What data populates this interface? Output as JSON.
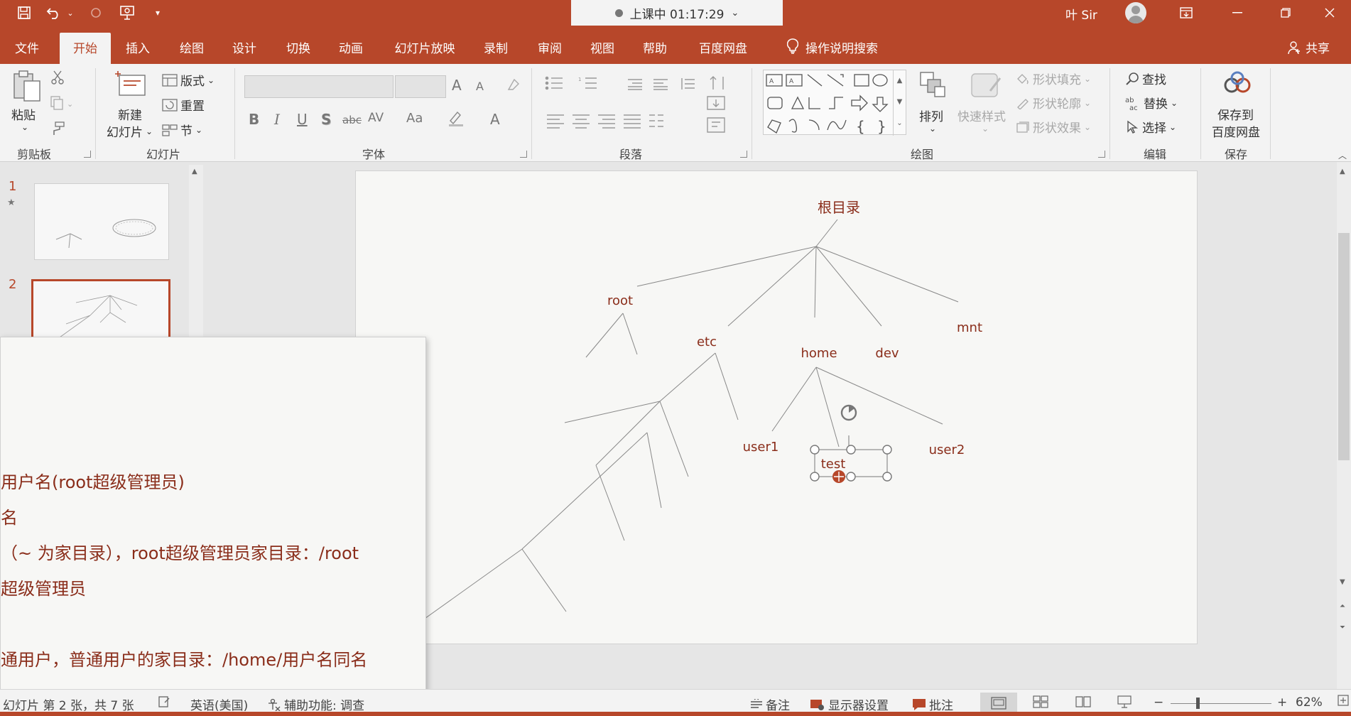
{
  "titlebar": {
    "recording_status": "上课中 01:17:29",
    "user_name": "叶 Sir",
    "colors": {
      "accent": "#b7472a",
      "text_red": "#8a2d1a"
    }
  },
  "menu": {
    "tabs": [
      "文件",
      "开始",
      "插入",
      "绘图",
      "设计",
      "切换",
      "动画",
      "幻灯片放映",
      "录制",
      "审阅",
      "视图",
      "帮助",
      "百度网盘"
    ],
    "active_tab": "开始",
    "tell_me": "操作说明搜索",
    "share": "共享"
  },
  "ribbon": {
    "clipboard": {
      "paste": "粘贴",
      "label": "剪贴板"
    },
    "slides": {
      "new_slide_1": "新建",
      "new_slide_2": "幻灯片",
      "layout": "版式",
      "reset": "重置",
      "section": "节",
      "label": "幻灯片"
    },
    "font": {
      "label": "字体",
      "bold": "B",
      "italic": "I",
      "underline": "U",
      "strike": "S",
      "abc": "abc",
      "av": "AV",
      "aa": "Aa",
      "a_color": "A",
      "grow": "A",
      "shrink": "A"
    },
    "paragraph": {
      "label": "段落"
    },
    "drawing": {
      "arrange": "排列",
      "quick_styles": "快速样式",
      "shape_fill": "形状填充",
      "shape_outline": "形状轮廓",
      "shape_effects": "形状效果",
      "label": "绘图"
    },
    "editing": {
      "find": "查找",
      "replace": "替换",
      "select": "选择",
      "label": "编辑"
    },
    "save": {
      "save_to_1": "保存到",
      "save_to_2": "百度网盘",
      "label": "保存"
    }
  },
  "thumbs": {
    "num1": "1",
    "star": "★",
    "num2": "2"
  },
  "slide": {
    "tree": {
      "root_dir": "根目录",
      "root": "root",
      "etc": "etc",
      "home": "home",
      "dev": "dev",
      "mnt": "mnt",
      "user1": "user1",
      "user2": "user2",
      "test": "test"
    }
  },
  "notes": {
    "lines": [
      "用户名(root超级管理员)",
      "名",
      "（~ 为家目录），root超级管理员家目录：/root",
      "超级管理员",
      "通用户，普通用户的家目录：/home/用户名同名"
    ]
  },
  "status": {
    "slide_info": "幻灯片 第 2 张，共 7 张",
    "language": "英语(美国)",
    "accessibility": "辅助功能: 调查",
    "notes": "备注",
    "display_settings": "显示器设置",
    "comments": "批注",
    "zoom_minus": "−",
    "zoom_plus": "+",
    "zoom": "62%"
  }
}
